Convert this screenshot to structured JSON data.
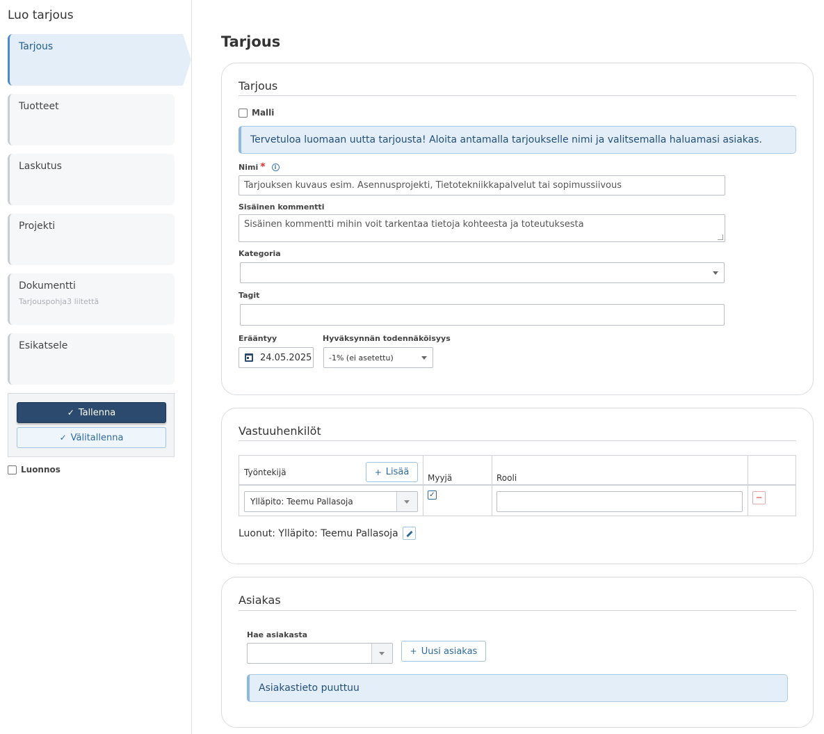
{
  "sidebar": {
    "title": "Luo tarjous",
    "steps": [
      {
        "label": "Tarjous",
        "sub": ""
      },
      {
        "label": "Tuotteet",
        "sub": ""
      },
      {
        "label": "Laskutus",
        "sub": ""
      },
      {
        "label": "Projekti",
        "sub": ""
      },
      {
        "label": "Dokumentti",
        "sub": "Tarjouspohja3 liitettä"
      },
      {
        "label": "Esikatsele",
        "sub": ""
      }
    ],
    "save_label": "Tallenna",
    "intermediate_save_label": "Välitallenna",
    "draft_label": "Luonnos"
  },
  "page_title": "Tarjous",
  "offer": {
    "title": "Tarjous",
    "template_label": "Malli",
    "welcome": "Tervetuloa luomaan uutta tarjousta! Aloita antamalla tarjoukselle nimi ja valitsemalla haluamasi asiakas.",
    "name_label": "Nimi",
    "required_mark": "*",
    "name_placeholder": "Tarjouksen kuvaus esim. Asennusprojekti, Tietotekniikkapalvelut tai sopimussiivous",
    "comment_label": "Sisäinen kommentti",
    "comment_placeholder": "Sisäinen kommentti mihin voit tarkentaa tietoja kohteesta ja toteutuksesta",
    "category_label": "Kategoria",
    "category_value": "",
    "tags_label": "Tagit",
    "tags_value": "",
    "due_label": "Erääntyy",
    "due_value": "24.05.2025",
    "probability_label": "Hyväksynnän todennäköisyys",
    "probability_value": "-1% (ei asetettu)"
  },
  "responsible": {
    "title": "Vastuuhenkilöt",
    "col_employee": "Työntekijä",
    "add_label": "Lisää",
    "col_seller": "Myyjä",
    "col_role": "Rooli",
    "rows": [
      {
        "employee": "Ylläpito: Teemu Pallasoja",
        "seller": true,
        "role": ""
      }
    ],
    "created_by": "Luonut: Ylläpito: Teemu Pallasoja"
  },
  "customer": {
    "title": "Asiakas",
    "search_label": "Hae asiakasta",
    "search_value": "",
    "new_customer_label": "Uusi asiakas",
    "missing_notice": "Asiakastieto puuttuu"
  },
  "colors": {
    "primary": "#2c4a6e",
    "accent": "#2c6aa0",
    "info_bg": "#e3eef8",
    "required": "#d9302c"
  }
}
